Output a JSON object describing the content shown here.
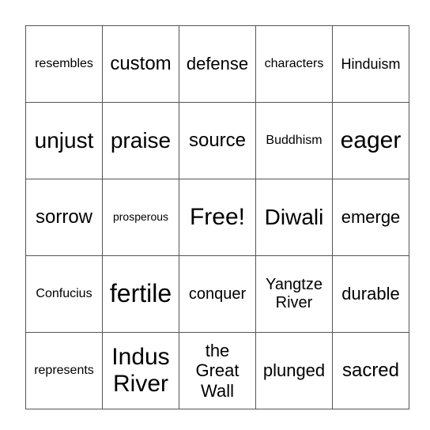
{
  "bingo": {
    "free_label": "Free!",
    "rows": [
      [
        "resembles",
        "custom",
        "defense",
        "characters",
        "Hinduism"
      ],
      [
        "unjust",
        "praise",
        "source",
        "Buddhism",
        "eager"
      ],
      [
        "sorrow",
        "prosperous",
        "Free!",
        "Diwali",
        "emerge"
      ],
      [
        "Confucius",
        "fertile",
        "conquer",
        "Yangtze River",
        "durable"
      ],
      [
        "represents",
        "Indus River",
        "the Great Wall",
        "plunged",
        "sacred"
      ]
    ]
  }
}
